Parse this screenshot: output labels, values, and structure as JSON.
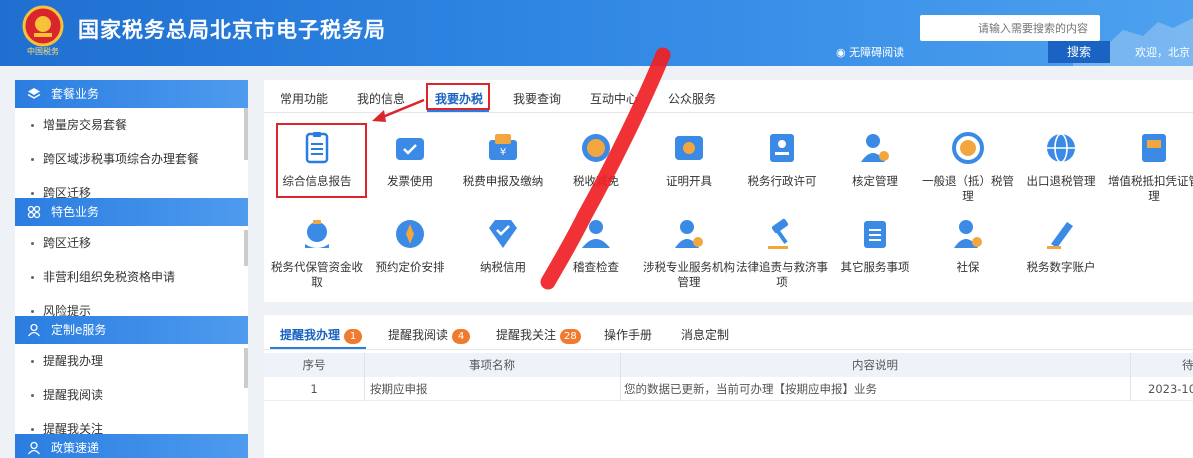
{
  "header": {
    "title": "国家税务总局北京市电子税务局",
    "search_placeholder": "请输入需要搜索的内容",
    "search_button": "搜索",
    "accessible_label": "无障碍阅读",
    "welcome": "欢迎，北京"
  },
  "sidebar": {
    "sections": [
      {
        "label": "套餐业务",
        "items": [
          "增量房交易套餐",
          "跨区域涉税事项综合办理套餐",
          "跨区迁移"
        ]
      },
      {
        "label": "特色业务",
        "items": [
          "跨区迁移",
          "非营利组织免税资格申请",
          "风险提示"
        ]
      },
      {
        "label": "定制e服务",
        "items": [
          "提醒我办理",
          "提醒我阅读",
          "提醒我关注"
        ]
      },
      {
        "label": "政策速递",
        "items": []
      }
    ]
  },
  "tabs": [
    "常用功能",
    "我的信息",
    "我要办税",
    "我要查询",
    "互动中心",
    "公众服务"
  ],
  "active_tab": "我要办税",
  "services_row1": [
    "综合信息报告",
    "发票使用",
    "税费申报及缴纳",
    "税收减免",
    "证明开具",
    "税务行政许可",
    "核定管理",
    "一般退（抵）税管理",
    "出口退税管理",
    "增值税抵扣凭证管理"
  ],
  "services_row2": [
    "税务代保管资金收取",
    "预约定价安排",
    "纳税信用",
    "稽查检查",
    "涉税专业服务机构管理",
    "法律追责与救济事项",
    "其它服务事项",
    "社保",
    "税务数字账户"
  ],
  "bottom_tabs": [
    {
      "label": "提醒我办理",
      "badge": "1"
    },
    {
      "label": "提醒我阅读",
      "badge": "4"
    },
    {
      "label": "提醒我关注",
      "badge": "28"
    },
    {
      "label": "操作手册",
      "badge": ""
    },
    {
      "label": "消息定制",
      "badge": ""
    }
  ],
  "table": {
    "headers": [
      "序号",
      "事项名称",
      "内容说明",
      "待"
    ],
    "rows": [
      [
        "1",
        "按期应申报",
        "您的数据已更新，当前可办理【按期应申报】业务",
        "2023-10"
      ]
    ]
  },
  "colors": {
    "brand_blue": "#2a7de0",
    "highlight_red": "#d9252b",
    "badge_orange": "#f07b2e"
  }
}
